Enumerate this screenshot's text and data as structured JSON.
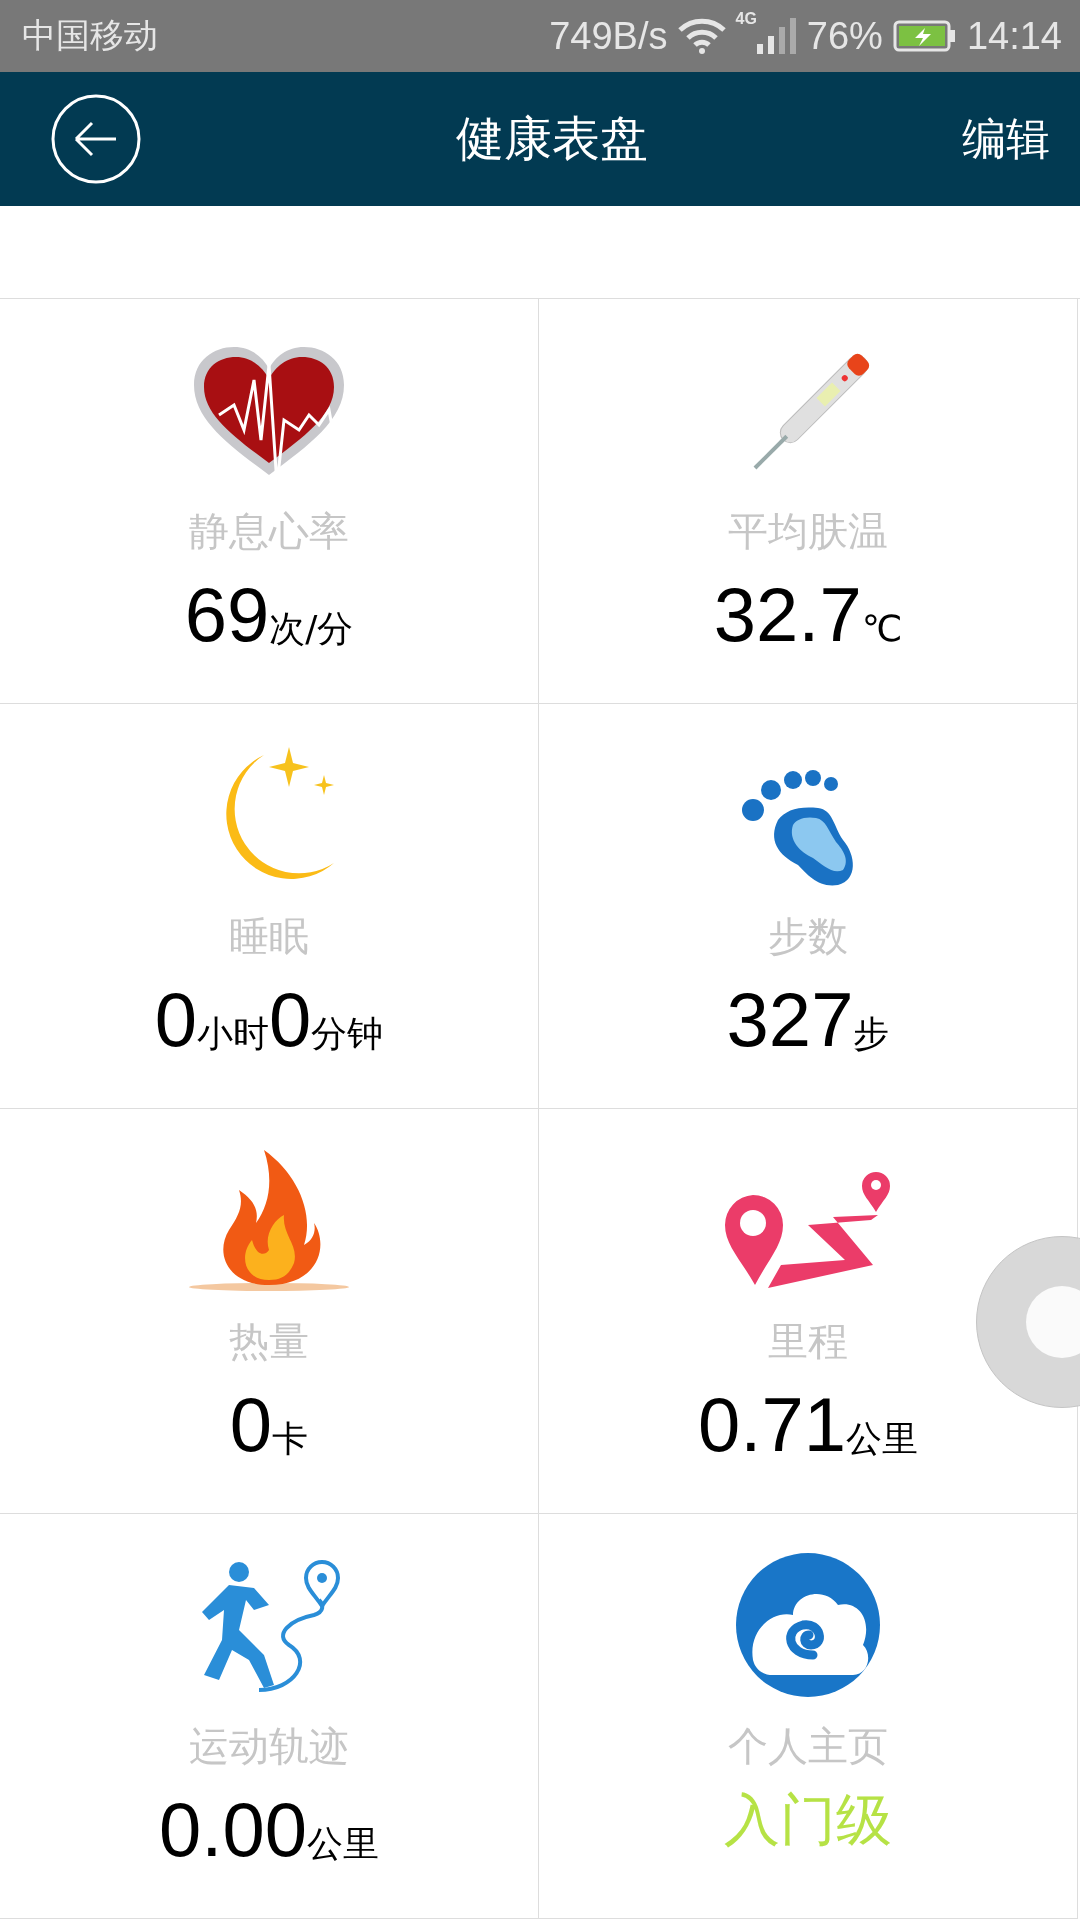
{
  "status_bar": {
    "carrier": "中国移动",
    "speed": "749B/s",
    "network": "4G",
    "battery": "76%",
    "time": "14:14"
  },
  "header": {
    "title": "健康表盘",
    "action": "编辑"
  },
  "cards": [
    {
      "label": "静息心率",
      "value": [
        {
          "kind": "number",
          "text": "69"
        },
        {
          "kind": "unit",
          "text": "次/分"
        }
      ]
    },
    {
      "label": "平均肤温",
      "value": [
        {
          "kind": "number",
          "text": "32.7"
        },
        {
          "kind": "unit",
          "text": "℃"
        }
      ]
    },
    {
      "label": "睡眠",
      "value": [
        {
          "kind": "number",
          "text": "0"
        },
        {
          "kind": "unit",
          "text": "小时"
        },
        {
          "kind": "number",
          "text": "0"
        },
        {
          "kind": "unit",
          "text": "分钟"
        }
      ]
    },
    {
      "label": "步数",
      "value": [
        {
          "kind": "number",
          "text": "327"
        },
        {
          "kind": "unit",
          "text": "步"
        }
      ]
    },
    {
      "label": "热量",
      "value": [
        {
          "kind": "number",
          "text": "0"
        },
        {
          "kind": "unit",
          "text": "卡"
        }
      ]
    },
    {
      "label": "里程",
      "value": [
        {
          "kind": "number",
          "text": "0.71"
        },
        {
          "kind": "unit",
          "text": "公里"
        }
      ]
    },
    {
      "label": "运动轨迹",
      "value": [
        {
          "kind": "number",
          "text": "0.00"
        },
        {
          "kind": "unit",
          "text": "公里"
        }
      ]
    },
    {
      "label": "个人主页",
      "value": [
        {
          "kind": "grade",
          "text": "入门级"
        }
      ]
    }
  ]
}
